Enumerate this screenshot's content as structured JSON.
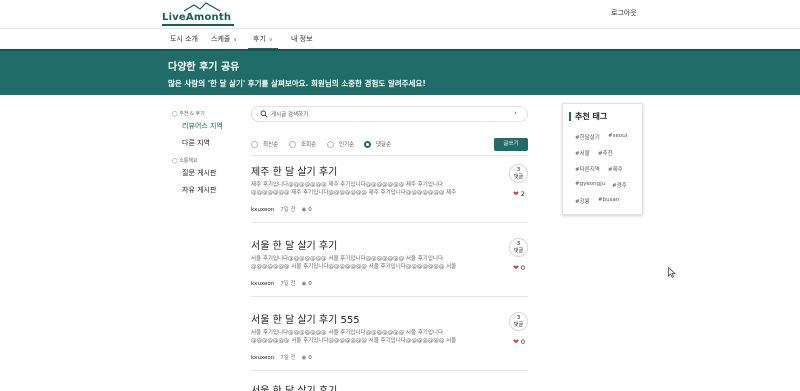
{
  "header": {
    "logo_text": "LiveAmonth",
    "logout_label": "로그아웃"
  },
  "nav": {
    "items": [
      {
        "label": "도시 소개",
        "has_dropdown": false
      },
      {
        "label": "스케줄",
        "has_dropdown": true
      },
      {
        "label": "후기",
        "has_dropdown": true,
        "active": true
      },
      {
        "label": "내 정보",
        "has_dropdown": false
      }
    ]
  },
  "banner": {
    "title": "다양한 후기 공유",
    "subtitle": "많은 사람의 '한 달 살기' 후기를 살펴보아요. 회원님의 소중한 경험도 알려주세요!"
  },
  "sidebar": {
    "group1_label": "추천 & 후기",
    "group1_items": [
      "리뷰어스 지역",
      "다른 지역"
    ],
    "group2_label": "소통해요",
    "group2_items": [
      "질문 게시판",
      "자유 게시판"
    ]
  },
  "search": {
    "placeholder": "게시글 검색하기"
  },
  "filters": {
    "options": [
      "최신순",
      "조회순",
      "인기순",
      "댓글순"
    ],
    "selected": "댓글순",
    "write_label": "글쓰기"
  },
  "posts": [
    {
      "title": "제주 한 달 살기 후기",
      "body": "제주 후기입니다@@@@@@@ 제주 후기입니다@@@@@@@ 제주 후기입니다@@@@@@@ 제주 후기입니다@@@@@@@ 제주 후기입니다@@@@@@@ 제주 후기입니다 ...",
      "author": "kxuxeon",
      "date": "7일 전",
      "views": "0",
      "comments": "3",
      "comments_label": "댓글",
      "likes": "2"
    },
    {
      "title": "서울 한 달 살기 후기",
      "body": "서울 후기입니다@@@@@@@ 서울 후기입니다@@@@@@@ 서울 후기입니다@@@@@@@ 서울 후기입니다@@@@@@@ 서울 후기입니다@@@@@@@ 서울 후기입니다 ...",
      "author": "kxuxeon",
      "date": "7일 전",
      "views": "0",
      "comments": "3",
      "comments_label": "댓글",
      "likes": "0"
    },
    {
      "title": "서울 한 달 살기 후기 555",
      "body": "서울 후기입니다@@@@@@@ 서울 후기입니다@@@@@@@ 서울 후기입니다@@@@@@@ 서울 후기입니다@@@@@@@ 서울 후기입니다@@@@@@@ 서울 후기입니다 ...",
      "author": "kxuxeon",
      "date": "7일 전",
      "views": "0",
      "comments": "3",
      "comments_label": "댓글",
      "likes": "0"
    },
    {
      "title": "서울 한 달 살기 후기",
      "body": "",
      "author": "",
      "date": "",
      "views": "",
      "comments": "",
      "comments_label": "",
      "likes": ""
    }
  ],
  "tags": {
    "title": "추천 태그",
    "items": [
      "#한달살기",
      "#seoul",
      "#서울",
      "#추천",
      "#다른지역",
      "#제주",
      "#gyeongju",
      "#경주",
      "#강릉",
      "#busan"
    ]
  },
  "colors": {
    "primary": "#1f6c69",
    "heart": "#d64552"
  }
}
